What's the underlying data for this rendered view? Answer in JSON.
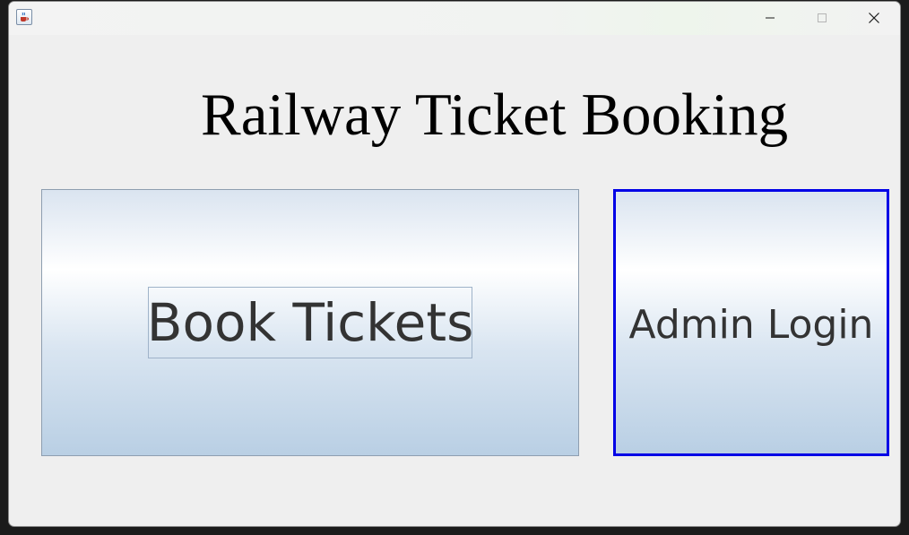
{
  "window": {
    "controls": {
      "minimize_icon": "minimize-icon",
      "maximize_icon": "maximize-icon",
      "close_icon": "close-icon"
    },
    "app_icon": "java-cup-icon"
  },
  "main": {
    "title": "Railway Ticket Booking",
    "book_button_label": "Book Tickets",
    "admin_button_label": "Admin Login"
  },
  "colors": {
    "window_bg": "#efefef",
    "focus_border": "#0000e6",
    "button_text": "#333333",
    "title_text": "#000000"
  }
}
